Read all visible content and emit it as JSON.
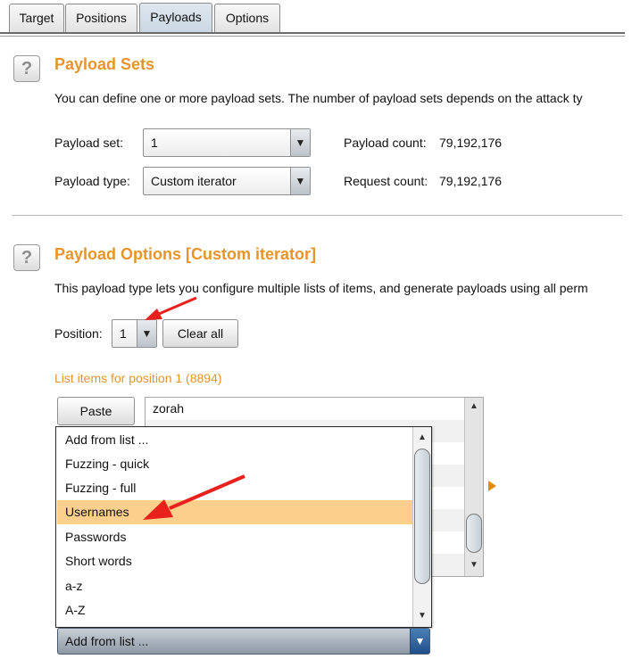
{
  "tabs": [
    {
      "label": "Target",
      "active": false
    },
    {
      "label": "Positions",
      "active": false
    },
    {
      "label": "Payloads",
      "active": true
    },
    {
      "label": "Options",
      "active": false
    }
  ],
  "payload_sets": {
    "title": "Payload Sets",
    "description": "You can define one or more payload sets. The number of payload sets depends on the attack ty",
    "payload_set_label": "Payload set:",
    "payload_set_value": "1",
    "payload_type_label": "Payload type:",
    "payload_type_value": "Custom iterator",
    "payload_count_label": "Payload count:",
    "payload_count_value": "79,192,176",
    "request_count_label": "Request count:",
    "request_count_value": "79,192,176"
  },
  "payload_options": {
    "title": "Payload Options [Custom iterator]",
    "description": "This payload type lets you configure multiple lists of items, and generate payloads using all perm",
    "position_label": "Position:",
    "position_value": "1",
    "clear_all_label": "Clear all",
    "list_heading": "List items for position 1 (8894)",
    "paste_label": "Paste",
    "list_items": [
      "zorah",
      "",
      "",
      "",
      "",
      "",
      "",
      ""
    ]
  },
  "dropdown": {
    "items": [
      "Add from list ...",
      "Fuzzing - quick",
      "Fuzzing - full",
      "Usernames",
      "Passwords",
      "Short words",
      "a-z",
      "A-Z"
    ],
    "selected_index": 3,
    "combo_value": "Add from list ..."
  },
  "icons": {
    "help": "help-icon",
    "dropdown_arrow": "▼",
    "scroll_up": "▲",
    "scroll_down": "▼"
  },
  "colors": {
    "accent_orange": "#e5952a",
    "selected_row": "#fccf8c",
    "annotation_red": "#e8211c"
  }
}
